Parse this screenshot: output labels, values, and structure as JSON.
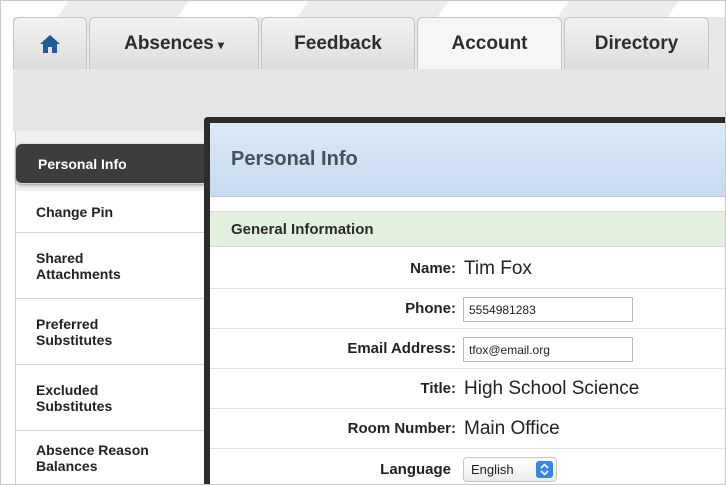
{
  "nav": {
    "home_icon": "home-icon",
    "tabs": [
      {
        "label": "Absences",
        "has_dropdown": true
      },
      {
        "label": "Feedback"
      },
      {
        "label": "Account",
        "active": true
      },
      {
        "label": "Directory"
      }
    ],
    "dropdown_glyph": "▾"
  },
  "sidebar": {
    "items": [
      {
        "lines": [
          "Personal Info"
        ],
        "active": true
      },
      {
        "lines": [
          "Change Pin"
        ]
      },
      {
        "lines": [
          "Shared",
          "Attachments"
        ]
      },
      {
        "lines": [
          "Preferred",
          "Substitutes"
        ]
      },
      {
        "lines": [
          "Excluded",
          "Substitutes"
        ]
      },
      {
        "lines": [
          "Absence Reason",
          "Balances"
        ]
      }
    ]
  },
  "panel": {
    "title": "Personal Info",
    "section": "General Information",
    "fields": {
      "name_label": "Name:",
      "name_value": "Tim Fox",
      "phone_label": "Phone:",
      "phone_value": "5554981283",
      "email_label": "Email Address:",
      "email_value": "tfox@email.org",
      "title_label": "Title:",
      "title_value": "High School Science",
      "room_label": "Room Number:",
      "room_value": "Main Office",
      "language_label": "Language",
      "language_value": "English"
    }
  },
  "colors": {
    "panel_border": "#2c2c2c",
    "panel_header": "#c7dbf1",
    "section_header": "#e3f0de",
    "sidebar_active": "#3d3d3d",
    "select_accent": "#3a86e8"
  }
}
